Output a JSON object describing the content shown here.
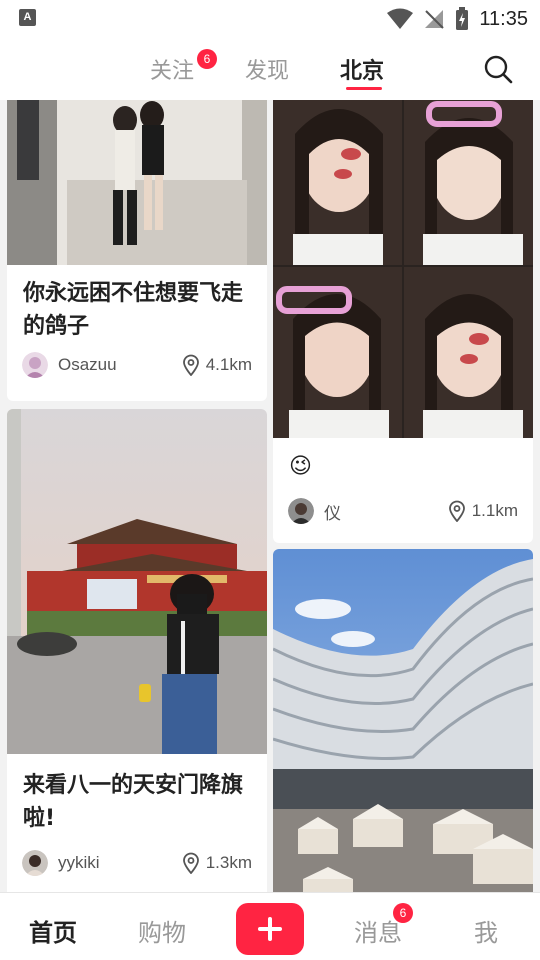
{
  "status_bar": {
    "time": "11:35",
    "app_icon": "A"
  },
  "top_nav": {
    "tabs": [
      {
        "label": "关注",
        "badge": "6"
      },
      {
        "label": "发现"
      },
      {
        "label": "北京",
        "active": true
      }
    ],
    "search_icon": "search-icon"
  },
  "feed": {
    "cards": [
      {
        "title": "你永远困不住想要飞走的鸽子",
        "user": "Osazuu",
        "distance": "4.1km"
      },
      {
        "title": "😉",
        "user": "仪",
        "distance": "1.1km"
      },
      {
        "title": "来看八一的天安门降旗啦!",
        "user": "yykiki",
        "distance": "1.3km"
      },
      {
        "title": "",
        "user": "",
        "distance": ""
      }
    ]
  },
  "bottom_nav": {
    "items": [
      {
        "label": "首页",
        "active": true
      },
      {
        "label": "购物"
      },
      {
        "label": "消息",
        "badge": "6"
      },
      {
        "label": "我"
      }
    ],
    "plus_icon": "plus-icon"
  },
  "colors": {
    "accent": "#ff2442",
    "background": "#f2f2f2"
  }
}
